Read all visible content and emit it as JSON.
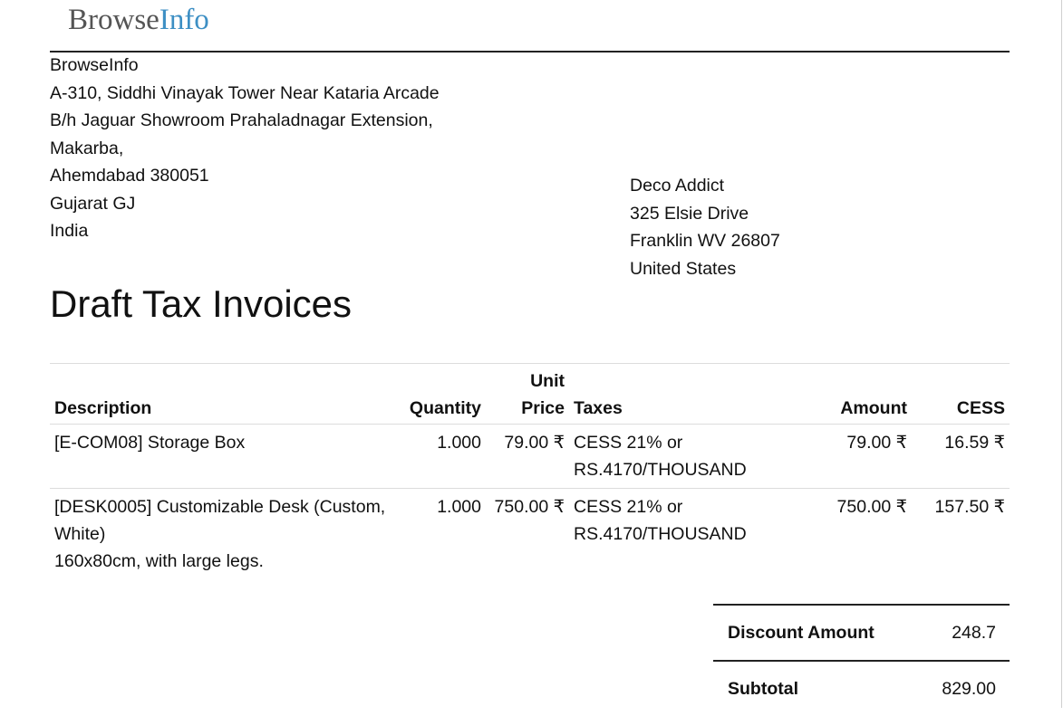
{
  "logo": {
    "part1": "Browse",
    "part2": "Info"
  },
  "company": {
    "lines": [
      "BrowseInfo",
      "A-310, Siddhi Vinayak Tower Near Kataria Arcade",
      "B/h Jaguar Showroom Prahaladnagar Extension,",
      "Makarba,",
      "Ahemdabad 380051",
      "Gujarat GJ",
      "India"
    ]
  },
  "partner": {
    "lines": [
      "Deco Addict",
      "325 Elsie Drive",
      "Franklin WV 26807",
      "United States"
    ]
  },
  "document": {
    "title": "Draft Tax Invoices"
  },
  "table": {
    "headers": {
      "description": "Description",
      "quantity": "Quantity",
      "unit_price_1": "Unit",
      "unit_price_2": "Price",
      "taxes": "Taxes",
      "amount": "Amount",
      "cess": "CESS"
    },
    "rows": [
      {
        "description": "[E-COM08] Storage Box",
        "description_note": "",
        "quantity": "1.000",
        "unit_price": "79.00 ₹",
        "taxes_1": "CESS 21% or",
        "taxes_2": "RS.4170/THOUSAND",
        "amount": "79.00 ₹",
        "cess": "16.59 ₹"
      },
      {
        "description": "[DESK0005] Customizable Desk (Custom, White)",
        "description_note": "160x80cm, with large legs.",
        "quantity": "1.000",
        "unit_price": "750.00 ₹",
        "taxes_1": "CESS 21% or",
        "taxes_2": "RS.4170/THOUSAND",
        "amount": "750.00 ₹",
        "cess": "157.50 ₹"
      }
    ]
  },
  "totals": {
    "discount_label": "Discount Amount",
    "discount_value": "248.7",
    "subtotal_label": "Subtotal",
    "subtotal_value": "829.00"
  }
}
